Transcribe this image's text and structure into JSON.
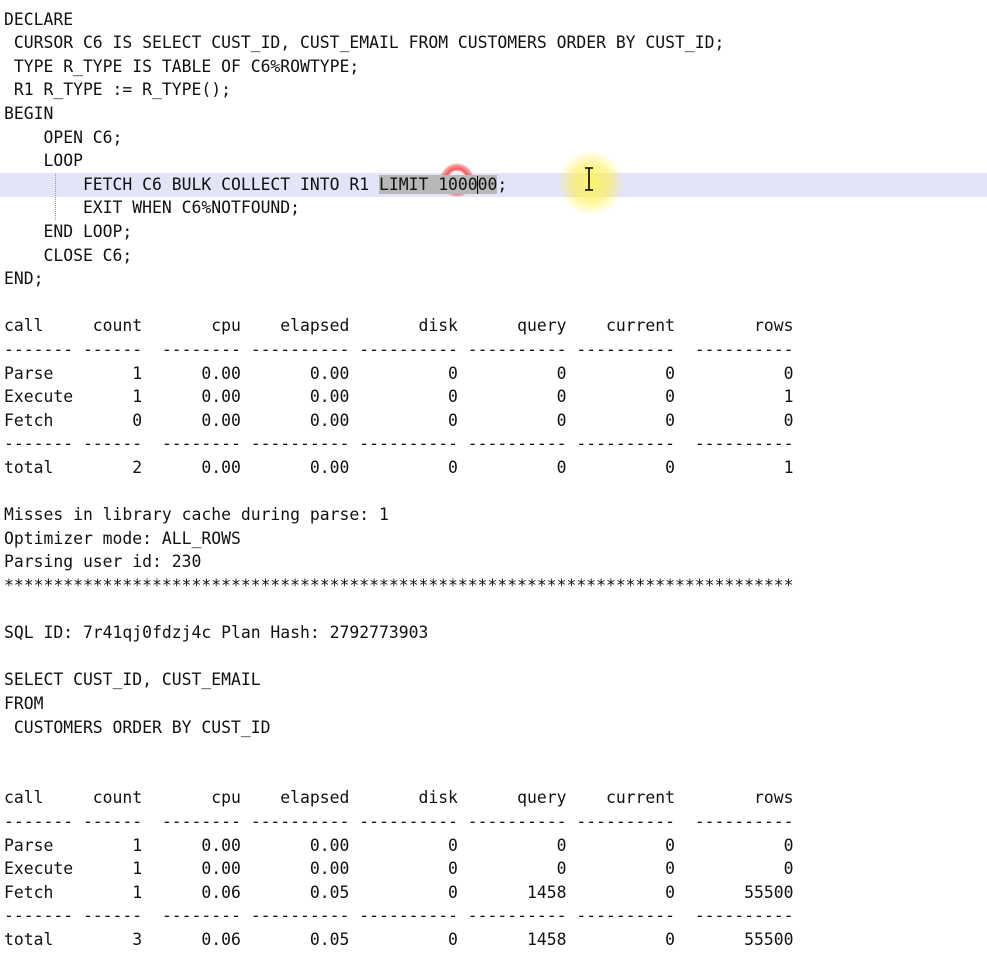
{
  "editor": {
    "lines": [
      "DECLARE",
      " CURSOR C6 IS SELECT CUST_ID, CUST_EMAIL FROM CUSTOMERS ORDER BY CUST_ID;",
      " TYPE R_TYPE IS TABLE OF C6%ROWTYPE;",
      " R1 R_TYPE := R_TYPE();",
      "BEGIN",
      "    OPEN C6;",
      "    LOOP",
      null,
      "        EXIT WHEN C6%NOTFOUND;",
      "    END LOOP;",
      "    CLOSE C6;",
      "END;",
      "",
      "call     count       cpu    elapsed       disk      query    current        rows",
      "------- ------  -------- ---------- ---------- ---------- ----------  ----------",
      "Parse        1      0.00       0.00          0          0          0           0",
      "Execute      1      0.00       0.00          0          0          0           1",
      "Fetch        0      0.00       0.00          0          0          0           0",
      "------- ------  -------- ---------- ---------- ---------- ----------  ----------",
      "total        2      0.00       0.00          0          0          0           1",
      "",
      "Misses in library cache during parse: 1",
      "Optimizer mode: ALL_ROWS",
      "Parsing user id: 230",
      "********************************************************************************",
      "",
      "SQL ID: 7r41qj0fdzj4c Plan Hash: 2792773903",
      "",
      "SELECT CUST_ID, CUST_EMAIL",
      "FROM",
      " CUSTOMERS ORDER BY CUST_ID",
      "",
      "",
      "call     count       cpu    elapsed       disk      query    current        rows",
      "------- ------  -------- ---------- ---------- ---------- ----------  ----------",
      "Parse        1      0.00       0.00          0          0          0           0",
      "Execute      1      0.00       0.00          0          0          0           0",
      "Fetch        1      0.06       0.05          0       1458          0       55500",
      "------- ------  -------- ---------- ---------- ---------- ----------  ----------",
      "total        3      0.06       0.05          0       1458          0       55500"
    ],
    "current_line": {
      "prefix": "        FETCH C6 BULK COLLECT INTO R1 ",
      "selected": "LIMIT 1000",
      "after_caret": "00",
      "suffix": ";"
    }
  }
}
